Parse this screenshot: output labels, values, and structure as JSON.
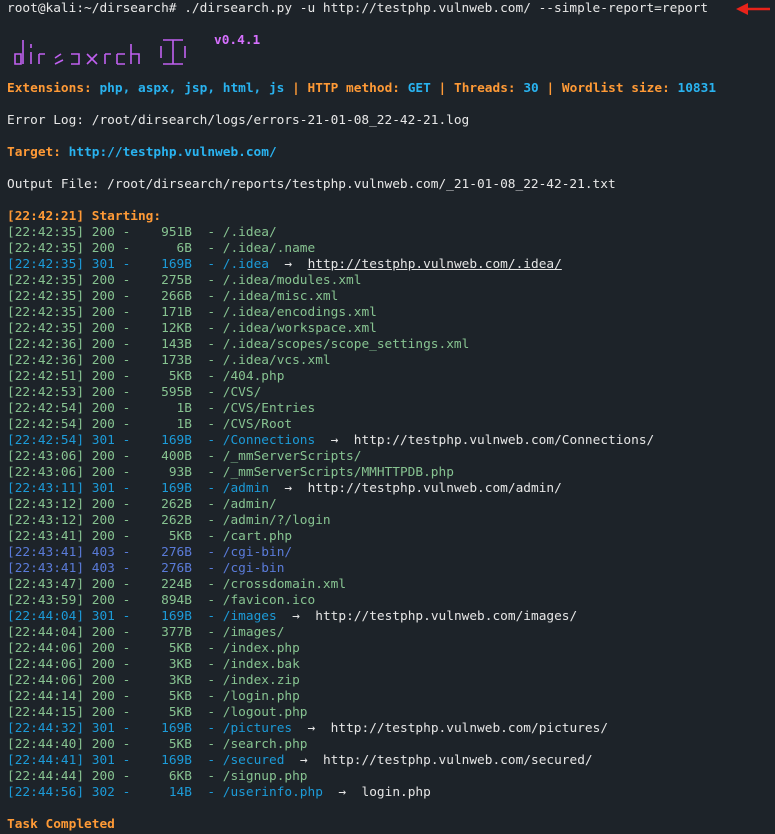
{
  "prompt": "root@kali:~/dirsearch# ./dirsearch.py -u http://testphp.vulnweb.com/ --simple-report=report",
  "logo_text": "dirsearch",
  "version": "v0.4.1",
  "config": {
    "ext_label": "Extensions:",
    "ext_value": "php, aspx, jsp, html, js",
    "sep": "|",
    "method_label": "HTTP method:",
    "method_value": "GET",
    "threads_label": "Threads:",
    "threads_value": "30",
    "wordlist_label": "Wordlist size:",
    "wordlist_value": "10831"
  },
  "error_log": "Error Log: /root/dirsearch/logs/errors-21-01-08_22-42-21.log",
  "target_label": "Target:",
  "target_value": "http://testphp.vulnweb.com/",
  "output_file": "Output File: /root/dirsearch/reports/testphp.vulnweb.com/_21-01-08_22-42-21.txt",
  "starting": "[22:42:21] Starting:",
  "arrow_glyph": "→",
  "results": [
    {
      "time": "[22:42:35]",
      "code": "200",
      "size": "951B",
      "path": "/.idea/",
      "redirect": "",
      "kind": "ok"
    },
    {
      "time": "[22:42:35]",
      "code": "200",
      "size": "6B",
      "path": "/.idea/.name",
      "redirect": "",
      "kind": "ok"
    },
    {
      "time": "[22:42:35]",
      "code": "301",
      "size": "169B",
      "path": "/.idea",
      "redirect": "http://testphp.vulnweb.com/.idea/",
      "kind": "redir",
      "underline": true
    },
    {
      "time": "[22:42:35]",
      "code": "200",
      "size": "275B",
      "path": "/.idea/modules.xml",
      "redirect": "",
      "kind": "ok"
    },
    {
      "time": "[22:42:35]",
      "code": "200",
      "size": "266B",
      "path": "/.idea/misc.xml",
      "redirect": "",
      "kind": "ok"
    },
    {
      "time": "[22:42:35]",
      "code": "200",
      "size": "171B",
      "path": "/.idea/encodings.xml",
      "redirect": "",
      "kind": "ok"
    },
    {
      "time": "[22:42:35]",
      "code": "200",
      "size": "12KB",
      "path": "/.idea/workspace.xml",
      "redirect": "",
      "kind": "ok"
    },
    {
      "time": "[22:42:36]",
      "code": "200",
      "size": "143B",
      "path": "/.idea/scopes/scope_settings.xml",
      "redirect": "",
      "kind": "ok"
    },
    {
      "time": "[22:42:36]",
      "code": "200",
      "size": "173B",
      "path": "/.idea/vcs.xml",
      "redirect": "",
      "kind": "ok"
    },
    {
      "time": "[22:42:51]",
      "code": "200",
      "size": "5KB",
      "path": "/404.php",
      "redirect": "",
      "kind": "ok"
    },
    {
      "time": "[22:42:53]",
      "code": "200",
      "size": "595B",
      "path": "/CVS/",
      "redirect": "",
      "kind": "ok"
    },
    {
      "time": "[22:42:54]",
      "code": "200",
      "size": "1B",
      "path": "/CVS/Entries",
      "redirect": "",
      "kind": "ok"
    },
    {
      "time": "[22:42:54]",
      "code": "200",
      "size": "1B",
      "path": "/CVS/Root",
      "redirect": "",
      "kind": "ok"
    },
    {
      "time": "[22:42:54]",
      "code": "301",
      "size": "169B",
      "path": "/Connections",
      "redirect": "http://testphp.vulnweb.com/Connections/",
      "kind": "redir"
    },
    {
      "time": "[22:43:06]",
      "code": "200",
      "size": "400B",
      "path": "/_mmServerScripts/",
      "redirect": "",
      "kind": "ok"
    },
    {
      "time": "[22:43:06]",
      "code": "200",
      "size": "93B",
      "path": "/_mmServerScripts/MMHTTPDB.php",
      "redirect": "",
      "kind": "ok"
    },
    {
      "time": "[22:43:11]",
      "code": "301",
      "size": "169B",
      "path": "/admin",
      "redirect": "http://testphp.vulnweb.com/admin/",
      "kind": "redir"
    },
    {
      "time": "[22:43:12]",
      "code": "200",
      "size": "262B",
      "path": "/admin/",
      "redirect": "",
      "kind": "ok"
    },
    {
      "time": "[22:43:12]",
      "code": "200",
      "size": "262B",
      "path": "/admin/?/login",
      "redirect": "",
      "kind": "ok"
    },
    {
      "time": "[22:43:41]",
      "code": "200",
      "size": "5KB",
      "path": "/cart.php",
      "redirect": "",
      "kind": "ok"
    },
    {
      "time": "[22:43:41]",
      "code": "403",
      "size": "276B",
      "path": "/cgi-bin/",
      "redirect": "",
      "kind": "forbidden"
    },
    {
      "time": "[22:43:41]",
      "code": "403",
      "size": "276B",
      "path": "/cgi-bin",
      "redirect": "",
      "kind": "forbidden"
    },
    {
      "time": "[22:43:47]",
      "code": "200",
      "size": "224B",
      "path": "/crossdomain.xml",
      "redirect": "",
      "kind": "ok"
    },
    {
      "time": "[22:43:59]",
      "code": "200",
      "size": "894B",
      "path": "/favicon.ico",
      "redirect": "",
      "kind": "ok"
    },
    {
      "time": "[22:44:04]",
      "code": "301",
      "size": "169B",
      "path": "/images",
      "redirect": "http://testphp.vulnweb.com/images/",
      "kind": "redir"
    },
    {
      "time": "[22:44:04]",
      "code": "200",
      "size": "377B",
      "path": "/images/",
      "redirect": "",
      "kind": "ok"
    },
    {
      "time": "[22:44:06]",
      "code": "200",
      "size": "5KB",
      "path": "/index.php",
      "redirect": "",
      "kind": "ok"
    },
    {
      "time": "[22:44:06]",
      "code": "200",
      "size": "3KB",
      "path": "/index.bak",
      "redirect": "",
      "kind": "ok"
    },
    {
      "time": "[22:44:06]",
      "code": "200",
      "size": "3KB",
      "path": "/index.zip",
      "redirect": "",
      "kind": "ok"
    },
    {
      "time": "[22:44:14]",
      "code": "200",
      "size": "5KB",
      "path": "/login.php",
      "redirect": "",
      "kind": "ok"
    },
    {
      "time": "[22:44:15]",
      "code": "200",
      "size": "5KB",
      "path": "/logout.php",
      "redirect": "",
      "kind": "ok"
    },
    {
      "time": "[22:44:32]",
      "code": "301",
      "size": "169B",
      "path": "/pictures",
      "redirect": "http://testphp.vulnweb.com/pictures/",
      "kind": "redir"
    },
    {
      "time": "[22:44:40]",
      "code": "200",
      "size": "5KB",
      "path": "/search.php",
      "redirect": "",
      "kind": "ok"
    },
    {
      "time": "[22:44:41]",
      "code": "301",
      "size": "169B",
      "path": "/secured",
      "redirect": "http://testphp.vulnweb.com/secured/",
      "kind": "redir"
    },
    {
      "time": "[22:44:44]",
      "code": "200",
      "size": "6KB",
      "path": "/signup.php",
      "redirect": "",
      "kind": "ok"
    },
    {
      "time": "[22:44:56]",
      "code": "302",
      "size": "14B",
      "path": "/userinfo.php",
      "redirect": "login.php",
      "kind": "redir"
    }
  ],
  "task_completed": "Task Completed",
  "colors": {
    "background": "#1d2329",
    "orange": "#ff9a36",
    "cyan": "#29b3f0",
    "ok_row": "#87c391",
    "redirect_row": "#1c9bd8",
    "forbidden_row": "#5a7bd9",
    "version": "#d770ff",
    "arrow_marker": "#e8231a"
  }
}
